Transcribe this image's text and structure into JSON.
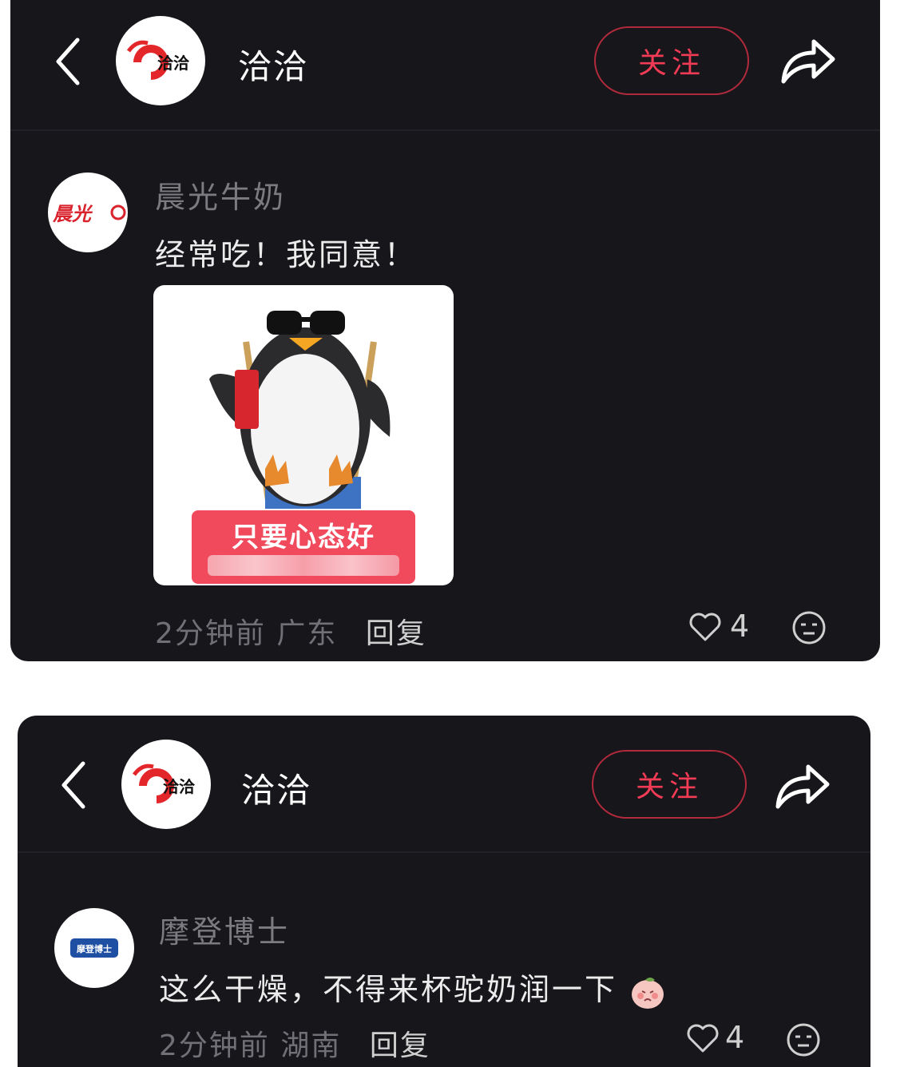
{
  "posts": [
    {
      "header": {
        "back_label": "back",
        "brand_logo_text": "洽洽",
        "brand_name": "洽洽",
        "follow_label": "关注"
      },
      "comment": {
        "user_logo_text": "晨光",
        "user_name": "晨光牛奶",
        "text": "经常吃！我同意！",
        "sticker_caption": "只要心态好",
        "time": "2分钟前",
        "location": "广东",
        "reply_label": "回复",
        "likes": "4"
      }
    },
    {
      "header": {
        "back_label": "back",
        "brand_logo_text": "洽洽",
        "brand_name": "洽洽",
        "follow_label": "关注"
      },
      "comment": {
        "user_logo_text": "摩登博士",
        "user_name": "摩登博士",
        "text": "这么干燥，不得来杯驼奶润一下",
        "time": "2分钟前",
        "location": "湖南",
        "reply_label": "回复",
        "likes": "4"
      }
    }
  ],
  "colors": {
    "card_bg": "#17161b",
    "accent_red": "#f23b55",
    "follow_border": "#b02a3c",
    "muted_text": "#7c7b80"
  },
  "icons": [
    "back-chevron-icon",
    "share-arrow-icon",
    "heart-icon",
    "emoji-icon"
  ]
}
